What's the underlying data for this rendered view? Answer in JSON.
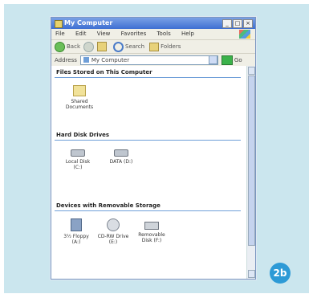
{
  "window": {
    "title": "My Computer",
    "menu": [
      "File",
      "Edit",
      "View",
      "Favorites",
      "Tools",
      "Help"
    ],
    "toolbar": {
      "back": "Back",
      "search": "Search",
      "folders": "Folders"
    },
    "address": {
      "label": "Address",
      "value": "My Computer",
      "go": "Go"
    }
  },
  "groups": {
    "stored": {
      "heading": "Files Stored on This Computer",
      "items": [
        {
          "label": "Shared Documents",
          "icon": "folder-icon"
        }
      ]
    },
    "hdd": {
      "heading": "Hard Disk Drives",
      "items": [
        {
          "label": "Local Disk (C:)",
          "icon": "hard-disk-icon"
        },
        {
          "label": "DATA (D:)",
          "icon": "hard-disk-icon"
        }
      ]
    },
    "removable": {
      "heading": "Devices with Removable Storage",
      "items": [
        {
          "label": "3½ Floppy (A:)",
          "icon": "floppy-icon"
        },
        {
          "label": "CD-RW Drive (E:)",
          "icon": "cd-drive-icon"
        },
        {
          "label": "Removable Disk (F:)",
          "icon": "removable-disk-icon"
        }
      ]
    }
  },
  "badge": "2b"
}
